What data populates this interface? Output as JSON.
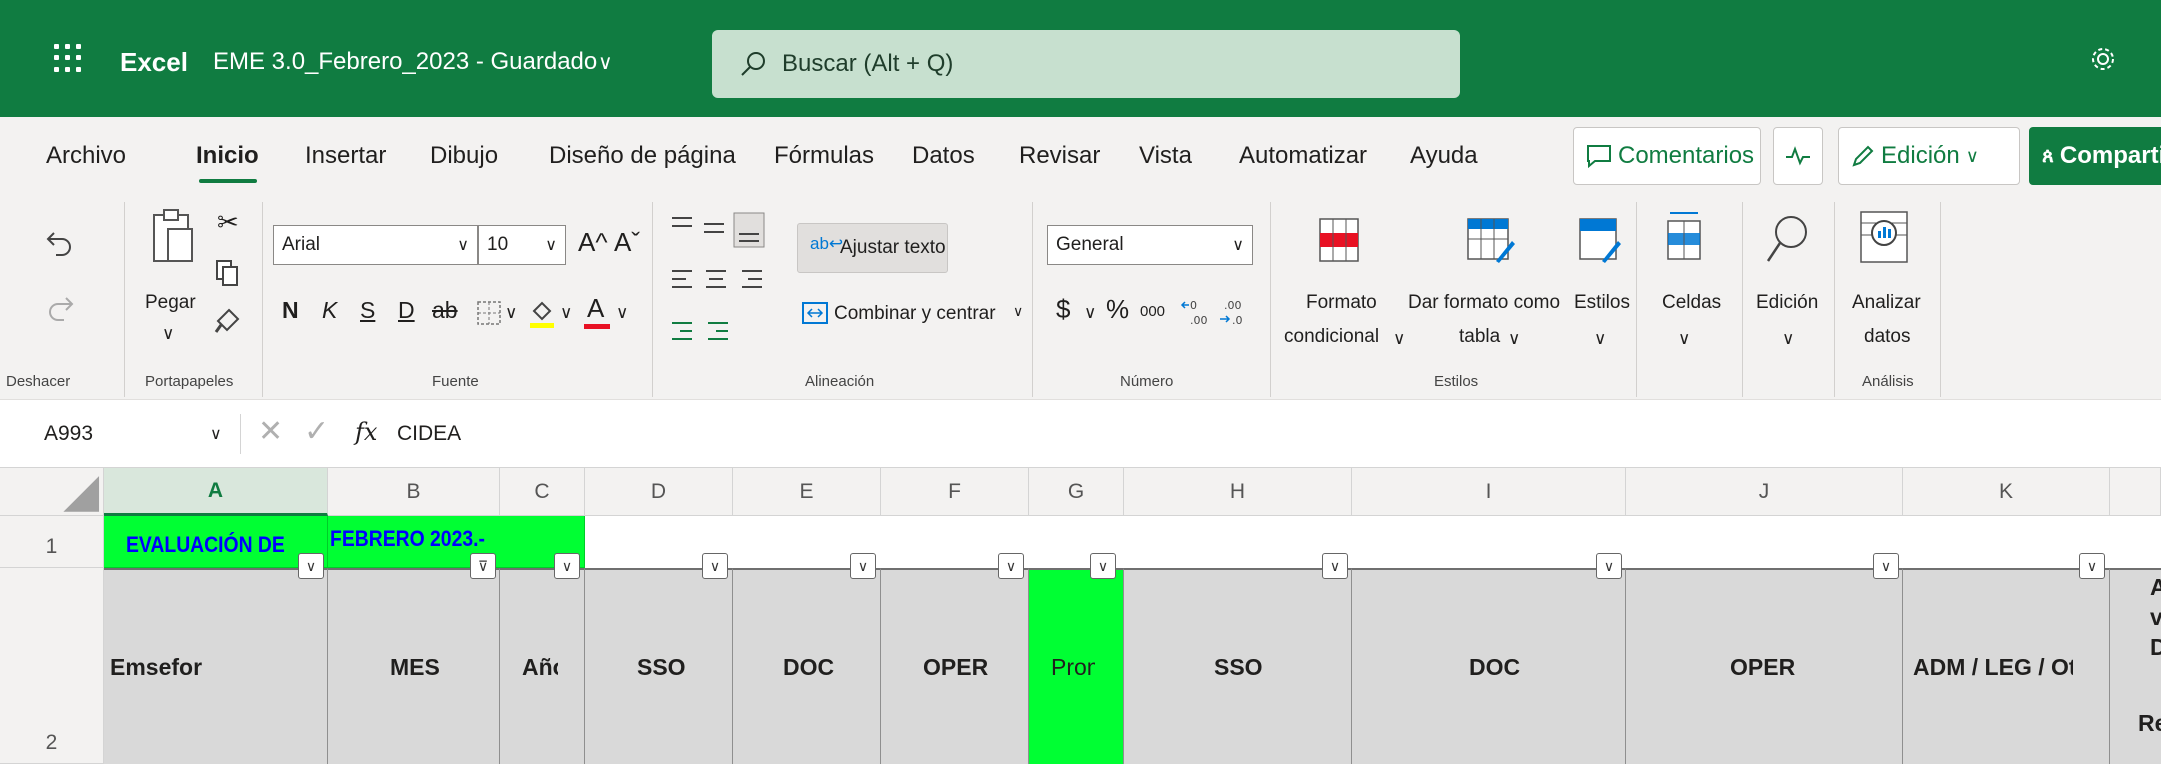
{
  "titlebar": {
    "app_name": "Excel",
    "document_title": "EME 3.0_Febrero_2023 - Guardado",
    "caret": "∨",
    "search_placeholder": "Buscar (Alt + Q)"
  },
  "tabs": [
    "Archivo",
    "Inicio",
    "Insertar",
    "Dibujo",
    "Diseño de página",
    "Fórmulas",
    "Datos",
    "Revisar",
    "Vista",
    "Automatizar",
    "Ayuda"
  ],
  "active_tab": "Inicio",
  "ribbon_right": {
    "comments_label": "Comentarios",
    "editing_label": "Edición",
    "share_label": "Comparti"
  },
  "groups": {
    "undo": {
      "label": "Deshacer"
    },
    "clipboard": {
      "label": "Portapapeles",
      "paste_label": "Pegar"
    },
    "font": {
      "label": "Fuente",
      "font_name": "Arial",
      "font_size": "10",
      "bold": "N",
      "italic": "K",
      "strike_s": "S",
      "underline": "D",
      "strike": "ab",
      "font_color": "A",
      "grow": "A^",
      "shrink": "Aˇ"
    },
    "alignment": {
      "label": "Alineación",
      "wrap_label": "Ajustar texto",
      "merge_label": "Combinar y centrar"
    },
    "number": {
      "label": "Número",
      "format": "General",
      "currency": "$",
      "percent": "%",
      "thousands": "000"
    },
    "styles": {
      "label": "Estilos",
      "conditional_line1": "Formato",
      "conditional_line2": "condicional",
      "table_line1": "Dar formato como",
      "table_line2": "tabla",
      "styles_label": "Estilos"
    },
    "cells": {
      "label": "Celdas"
    },
    "editing": {
      "label": "Edición"
    },
    "analysis": {
      "label": "Análisis",
      "line1": "Analizar",
      "line2": "datos"
    }
  },
  "formula_bar": {
    "name_box": "A993",
    "fx": "fx",
    "content": "CIDEA"
  },
  "columns": [
    "A",
    "B",
    "C",
    "D",
    "E",
    "F",
    "G",
    "H",
    "I",
    "J",
    "K"
  ],
  "rows": [
    "1",
    "2"
  ],
  "row1": {
    "a": "EVALUACIÓN DE",
    "b": "FEBRERO 2023.-"
  },
  "headers": [
    "Emsefor",
    "MES",
    "Año",
    "SSO",
    "DOC",
    "OPER",
    "Prom",
    "SSO",
    "DOC",
    "OPER",
    "ADM / LEG / Otro"
  ],
  "edge_fragments": [
    "A",
    "v",
    "D",
    "Rec"
  ],
  "colors": {
    "excel_green": "#107c41",
    "bright_green": "#00ff33",
    "header_gray": "#d9d9d9",
    "blue_text": "#0000ff"
  }
}
